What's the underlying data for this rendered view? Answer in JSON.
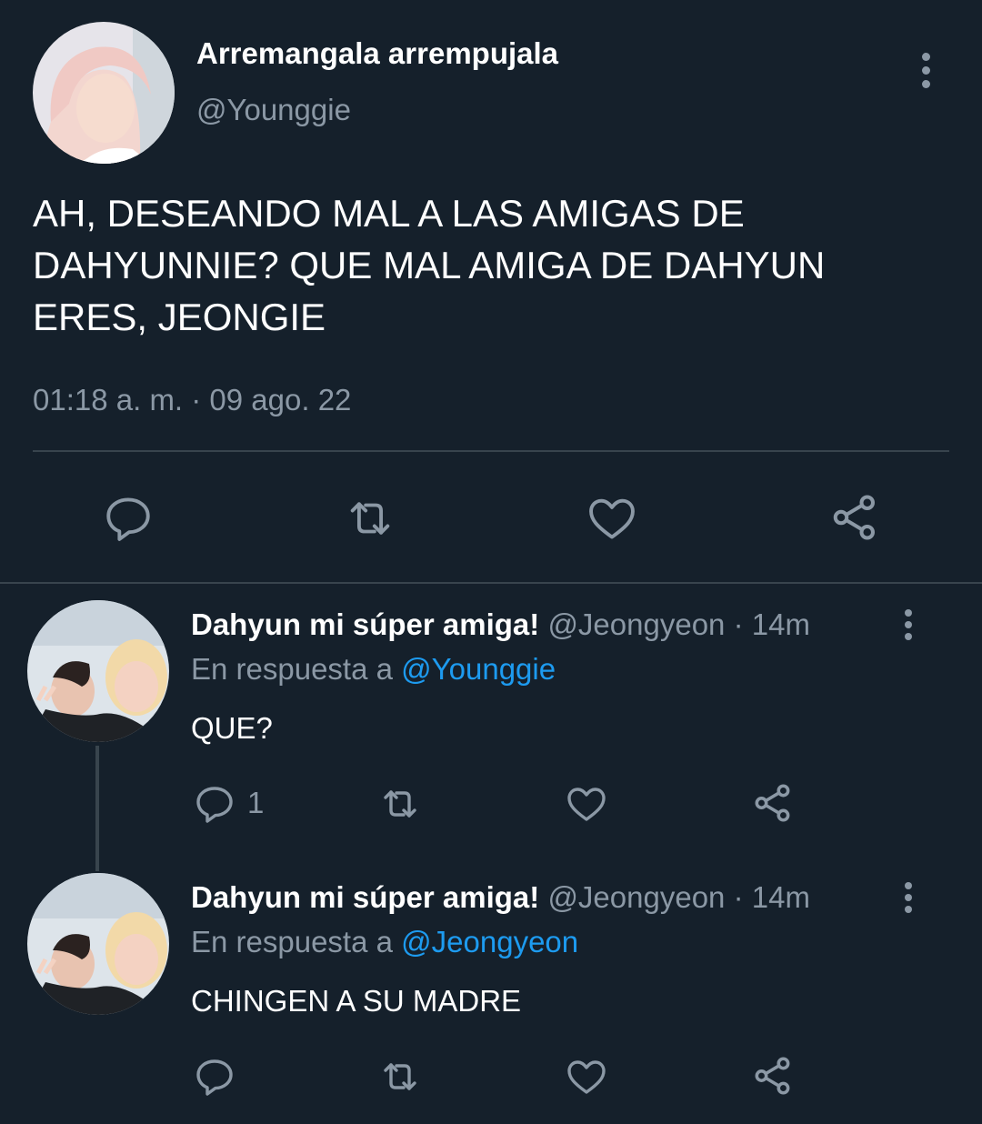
{
  "main_tweet": {
    "display_name": "Arremangala arrempujala",
    "handle": "@Younggie",
    "text": "AH, DESEANDO MAL A LAS AMIGAS DE DAHYUNNIE? QUE MAL AMIGA DE DAHYUN ERES, JEONGIE",
    "timestamp": "01:18 a. m. · 09 ago. 22",
    "actions": [
      "reply-icon",
      "retweet-icon",
      "like-icon",
      "share-icon"
    ]
  },
  "replies": [
    {
      "display_name": "Dahyun mi súper amiga!",
      "handle": "@Jeongyeon",
      "time": "· 14m",
      "reply_prefix": "En respuesta a",
      "reply_to": "@Younggie",
      "text": "QUE?",
      "reply_count": "1"
    },
    {
      "display_name": "Dahyun mi súper amiga!",
      "handle": "@Jeongyeon",
      "time": "· 14m",
      "reply_prefix": "En respuesta a",
      "reply_to": "@Jeongyeon",
      "text": "CHINGEN A SU MADRE",
      "reply_count": ""
    }
  ],
  "colors": {
    "background": "#15202b",
    "muted": "#8b98a5",
    "link": "#1d9bf0",
    "divider": "#38444d"
  }
}
